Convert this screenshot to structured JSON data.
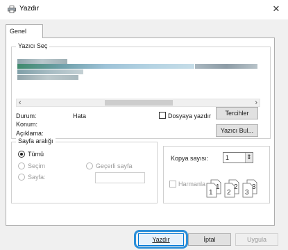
{
  "window": {
    "title": "Yazdır",
    "close_label": "✕"
  },
  "tabs": {
    "general": "Genel"
  },
  "printer": {
    "group_title": "Yazıcı Seç",
    "scroll_left": "‹",
    "scroll_right": "›",
    "status_label": "Durum:",
    "status_value": "Hata",
    "location_label": "Konum:",
    "comment_label": "Açıklama:",
    "print_to_file_label": "Dosyaya yazdır",
    "preferences_button": "Tercihler",
    "find_printer_button": "Yazıcı Bul..."
  },
  "page_range": {
    "group_title": "Sayfa aralığı",
    "all_label": "Tümü",
    "selection_label": "Seçim",
    "current_page_label": "Geçerli sayfa",
    "pages_label": "Sayfa:",
    "pages_value": ""
  },
  "copies": {
    "label": "Kopya sayısı:",
    "value": "1",
    "spin_icon": "⇕",
    "collate_label": "Harmanla",
    "collate_illustration": [
      "1",
      "1",
      "2",
      "2",
      "3",
      "3"
    ]
  },
  "footer": {
    "print_button": "Yazdır",
    "cancel_button": "İptal",
    "apply_button": "Uygula"
  }
}
